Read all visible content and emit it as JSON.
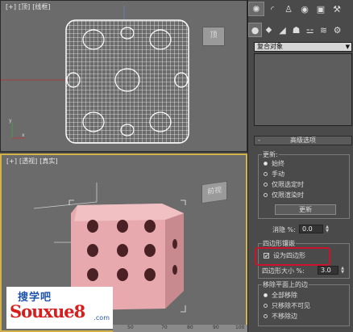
{
  "top_viewport": {
    "labels": [
      "[+]",
      "[顶]",
      "[线框]"
    ],
    "viewcube": "顶"
  },
  "persp_viewport": {
    "labels": [
      "[+]",
      "[透视]",
      "[真实]"
    ],
    "viewcube": "前视"
  },
  "panel": {
    "tabs": [
      "sun-icon",
      "curve-icon",
      "hierarchy-icon",
      "motion-icon",
      "display-icon",
      "utilities-icon"
    ],
    "subtabs": [
      "sphere-icon",
      "geometry-icon",
      "light-icon",
      "camera-icon",
      "helper-icon",
      "spacewarp-icon",
      "systems-icon"
    ],
    "dropdown": "复合对象",
    "rollout_title": "高级选项",
    "update_group": {
      "label": "更新:",
      "options": [
        "始终",
        "手动",
        "仅限选定时",
        "仅限渲染时"
      ],
      "selected": 0,
      "update_button": "更新"
    },
    "cull": {
      "label": "消隐 %:",
      "value": "0.0"
    },
    "quad_group": {
      "label": "四边形镶嵌",
      "checkbox_label": "设为四边形",
      "checked": true,
      "size_label": "四边形大小 %:",
      "size_value": "3.0"
    },
    "remove_group": {
      "label": "移除平面上的边",
      "options": [
        "全部移除",
        "只移除不可见",
        "不移除边"
      ],
      "selected": 0
    }
  },
  "logo": {
    "line1": "搜学吧",
    "line2": "Souxue8",
    "line3": ".com"
  },
  "ruler": [
    "50",
    "70",
    "80",
    "90",
    "100"
  ],
  "colors": {
    "highlight": "#c8142c",
    "active_border": "#d2b24a",
    "dice": "#e7a9ad"
  }
}
